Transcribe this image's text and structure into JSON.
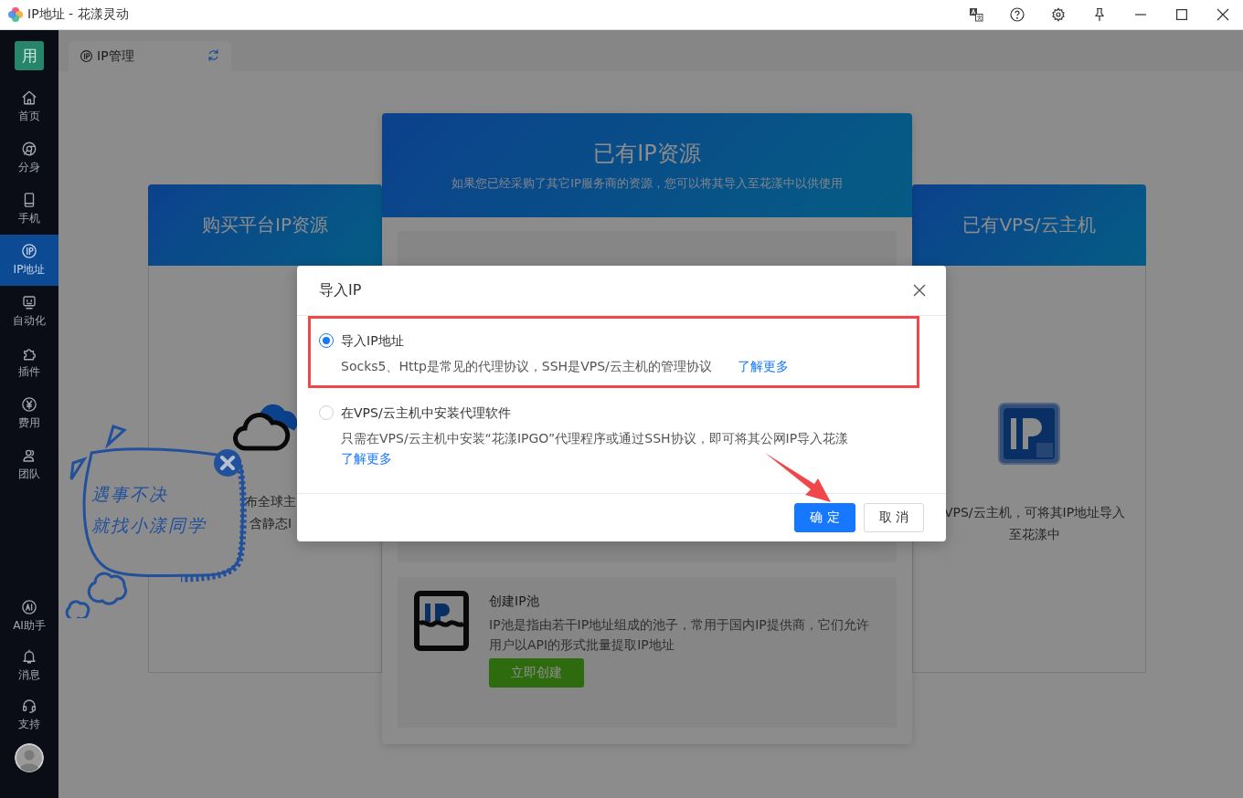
{
  "window": {
    "title": "IP地址 - 花漾灵动"
  },
  "sidebar": {
    "badge": "用",
    "items": [
      {
        "label": "首页",
        "selected": false
      },
      {
        "label": "分身",
        "selected": false
      },
      {
        "label": "手机",
        "selected": false
      },
      {
        "label": "IP地址",
        "selected": true
      },
      {
        "label": "自动化",
        "selected": false
      },
      {
        "label": "插件",
        "selected": false
      },
      {
        "label": "费用",
        "selected": false
      },
      {
        "label": "团队",
        "selected": false
      }
    ],
    "bottom_items": [
      {
        "label": "AI助手"
      },
      {
        "label": "消息"
      },
      {
        "label": "支持"
      }
    ]
  },
  "tabs": [
    {
      "label": "IP管理",
      "selected": true
    }
  ],
  "cards": [
    {
      "kind": "side",
      "title": "购买平台IP资源",
      "description_lines": [
        "布全球主",
        "含静态I"
      ]
    },
    {
      "kind": "main",
      "title": "已有IP资源",
      "subtitle": "如果您已经采购了其它IP服务商的资源，您可以将其导入至花漾中以供使用",
      "items": [
        {
          "title": "创建IP池",
          "description": "IP池是指由若干IP地址组成的池子，常用于国内IP提供商，它们允许用户以API的形式批量提取IP地址",
          "button": "立即创建"
        }
      ]
    },
    {
      "kind": "side",
      "title": "已有VPS/云主机",
      "description_lines": [
        "VPS/云主机，可将其IP地址导入",
        "至花漾中"
      ]
    }
  ],
  "assistant_bubble": {
    "lines": [
      "遇事不决",
      "就找小漾同学"
    ]
  },
  "modal": {
    "title": "导入IP",
    "options": [
      {
        "label": "导入IP地址",
        "description": "Socks5、Http是常见的代理协议，SSH是VPS/云主机的管理协议",
        "link": "了解更多",
        "selected": true,
        "highlighted": true
      },
      {
        "label": "在VPS/云主机中安装代理软件",
        "description": "只需在VPS/云主机中安装“花漾IPGO”代理程序或通过SSH协议，即可将其公网IP导入花漾",
        "link": "了解更多",
        "selected": false,
        "highlighted": false
      }
    ],
    "buttons": [
      {
        "label": "确 定",
        "kind": "primary"
      },
      {
        "label": "取 消",
        "kind": "default"
      }
    ]
  }
}
